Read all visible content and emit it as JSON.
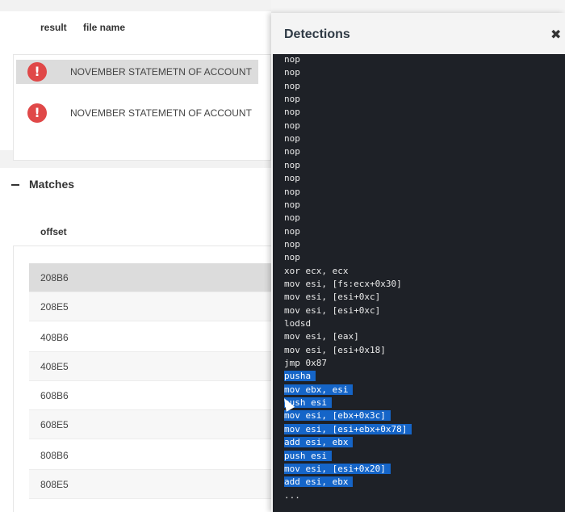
{
  "files": {
    "columns": {
      "result": "result",
      "file_name": "file name"
    },
    "rows": [
      {
        "icon": "!",
        "name": "NOVEMBER STATEMETN OF ACCOUNT",
        "selected": true
      },
      {
        "icon": "!",
        "name": "NOVEMBER STATEMETN OF ACCOUNT",
        "selected": false
      }
    ]
  },
  "matches": {
    "title": "Matches",
    "column": "offset",
    "rows": [
      "208B6",
      "208E5",
      "408B6",
      "408E5",
      "608B6",
      "608E5",
      "808B6",
      "808E5"
    ]
  },
  "detections": {
    "title": "Detections",
    "close": "✖",
    "lines": [
      "nop",
      "nop",
      "nop",
      "nop",
      "nop",
      "nop",
      "nop",
      "nop",
      "nop",
      "nop",
      "nop",
      "nop",
      "nop",
      "nop",
      "nop",
      "nop",
      "xor ecx, ecx",
      "mov esi, [fs:ecx+0x30]",
      "mov esi, [esi+0xc]",
      "mov esi, [esi+0xc]",
      "lodsd",
      "mov esi, [eax]",
      "mov esi, [esi+0x18]",
      "jmp 0x87",
      "pusha",
      "mov ebx, esi",
      "push esi",
      "mov esi, [ebx+0x3c]",
      "mov esi, [esi+ebx+0x78]",
      "add esi, ebx",
      "push esi",
      "mov esi, [esi+0x20]",
      "add esi, ebx",
      "..."
    ],
    "highlight_from": 24,
    "highlight_to": 32,
    "highlight_color": "#1565c8"
  },
  "colors": {
    "error": "#e04848",
    "code_bg": "#1e2127"
  }
}
